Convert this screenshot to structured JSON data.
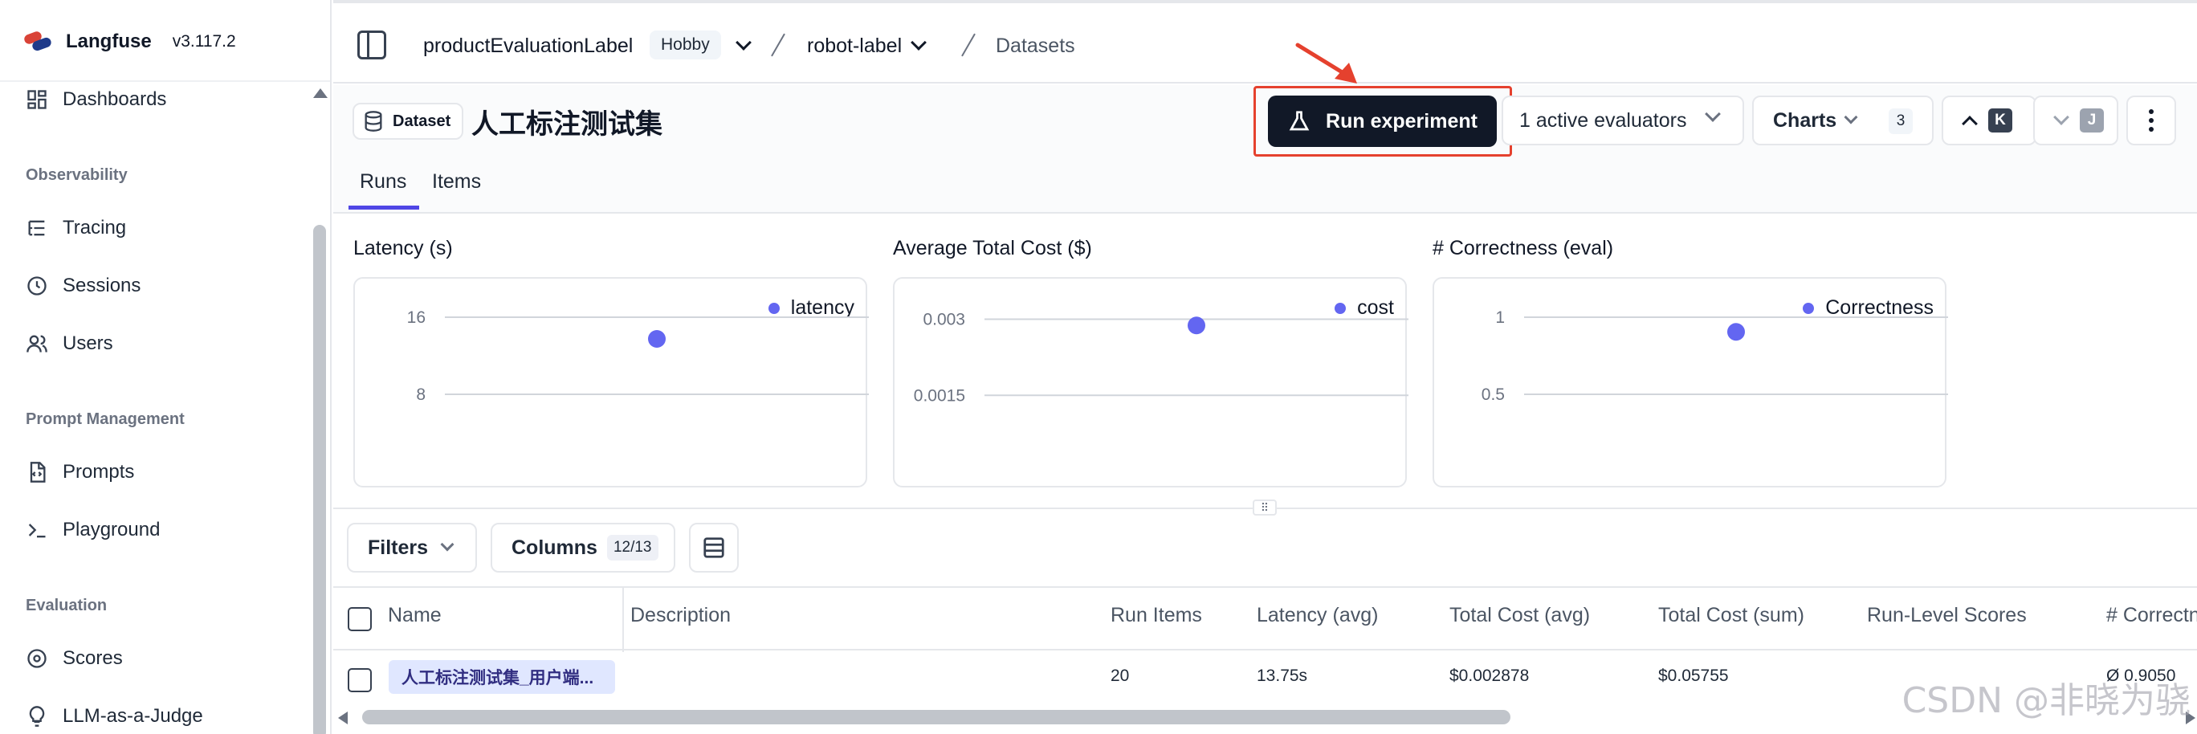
{
  "brand": {
    "name": "Langfuse",
    "version": "v3.117.2"
  },
  "sidebar": {
    "items": [
      {
        "label": "Dashboards",
        "icon": "dashboard-icon"
      },
      {
        "label": "Tracing",
        "icon": "list-tree-icon"
      },
      {
        "label": "Sessions",
        "icon": "clock-icon"
      },
      {
        "label": "Users",
        "icon": "users-icon"
      },
      {
        "label": "Prompts",
        "icon": "file-code-icon"
      },
      {
        "label": "Playground",
        "icon": "terminal-icon"
      },
      {
        "label": "Scores",
        "icon": "target-icon"
      },
      {
        "label": "LLM-as-a-Judge",
        "icon": "lightbulb-icon"
      }
    ],
    "sections": [
      "Observability",
      "Prompt Management",
      "Evaluation"
    ]
  },
  "breadcrumb": {
    "project": "productEvaluationLabel",
    "plan": "Hobby",
    "dataset": "robot-label",
    "page": "Datasets"
  },
  "header": {
    "badge": "Dataset",
    "title": "人工标注测试集",
    "run_experiment": "Run experiment",
    "evaluators": "1 active evaluators",
    "charts": "Charts",
    "charts_count": "3",
    "kbd_up": "K",
    "kbd_down": "J"
  },
  "tabs": [
    "Runs",
    "Items"
  ],
  "chart_data": [
    {
      "type": "scatter",
      "title": "Latency (s)",
      "series": [
        {
          "name": "latency",
          "values": [
            13.75
          ]
        }
      ],
      "ticks": [
        "16",
        "8"
      ],
      "ylim": [
        0,
        20
      ]
    },
    {
      "type": "scatter",
      "title": "Average Total Cost ($)",
      "series": [
        {
          "name": "cost",
          "values": [
            0.002878
          ]
        }
      ],
      "ticks": [
        "0.003",
        "0.0015"
      ],
      "ylim": [
        0,
        0.0038
      ]
    },
    {
      "type": "scatter",
      "title": "# Correctness (eval)",
      "series": [
        {
          "name": "Correctness",
          "values": [
            0.905
          ]
        }
      ],
      "ticks": [
        "1",
        "0.5"
      ],
      "ylim": [
        0,
        1.25
      ]
    }
  ],
  "toolbar": {
    "filters": "Filters",
    "columns": "Columns",
    "columns_count": "12/13"
  },
  "table": {
    "headers": [
      "Name",
      "Description",
      "Run Items",
      "Latency (avg)",
      "Total Cost (avg)",
      "Total Cost (sum)",
      "Run-Level Scores",
      "# Correctness"
    ],
    "rows": [
      {
        "name": "人工标注测试集_用户端...",
        "description": "",
        "run_items": "20",
        "latency": "13.75s",
        "cost_avg": "$0.002878",
        "cost_sum": "$0.05755",
        "run_level_scores": "",
        "correctness": "Ø 0.9050"
      }
    ]
  },
  "watermark": "CSDN @非晓为骁",
  "colors": {
    "accent": "#6366f1",
    "tab_underline": "#4f46e5",
    "run_button": "#111827",
    "highlight": "#e5412e"
  }
}
